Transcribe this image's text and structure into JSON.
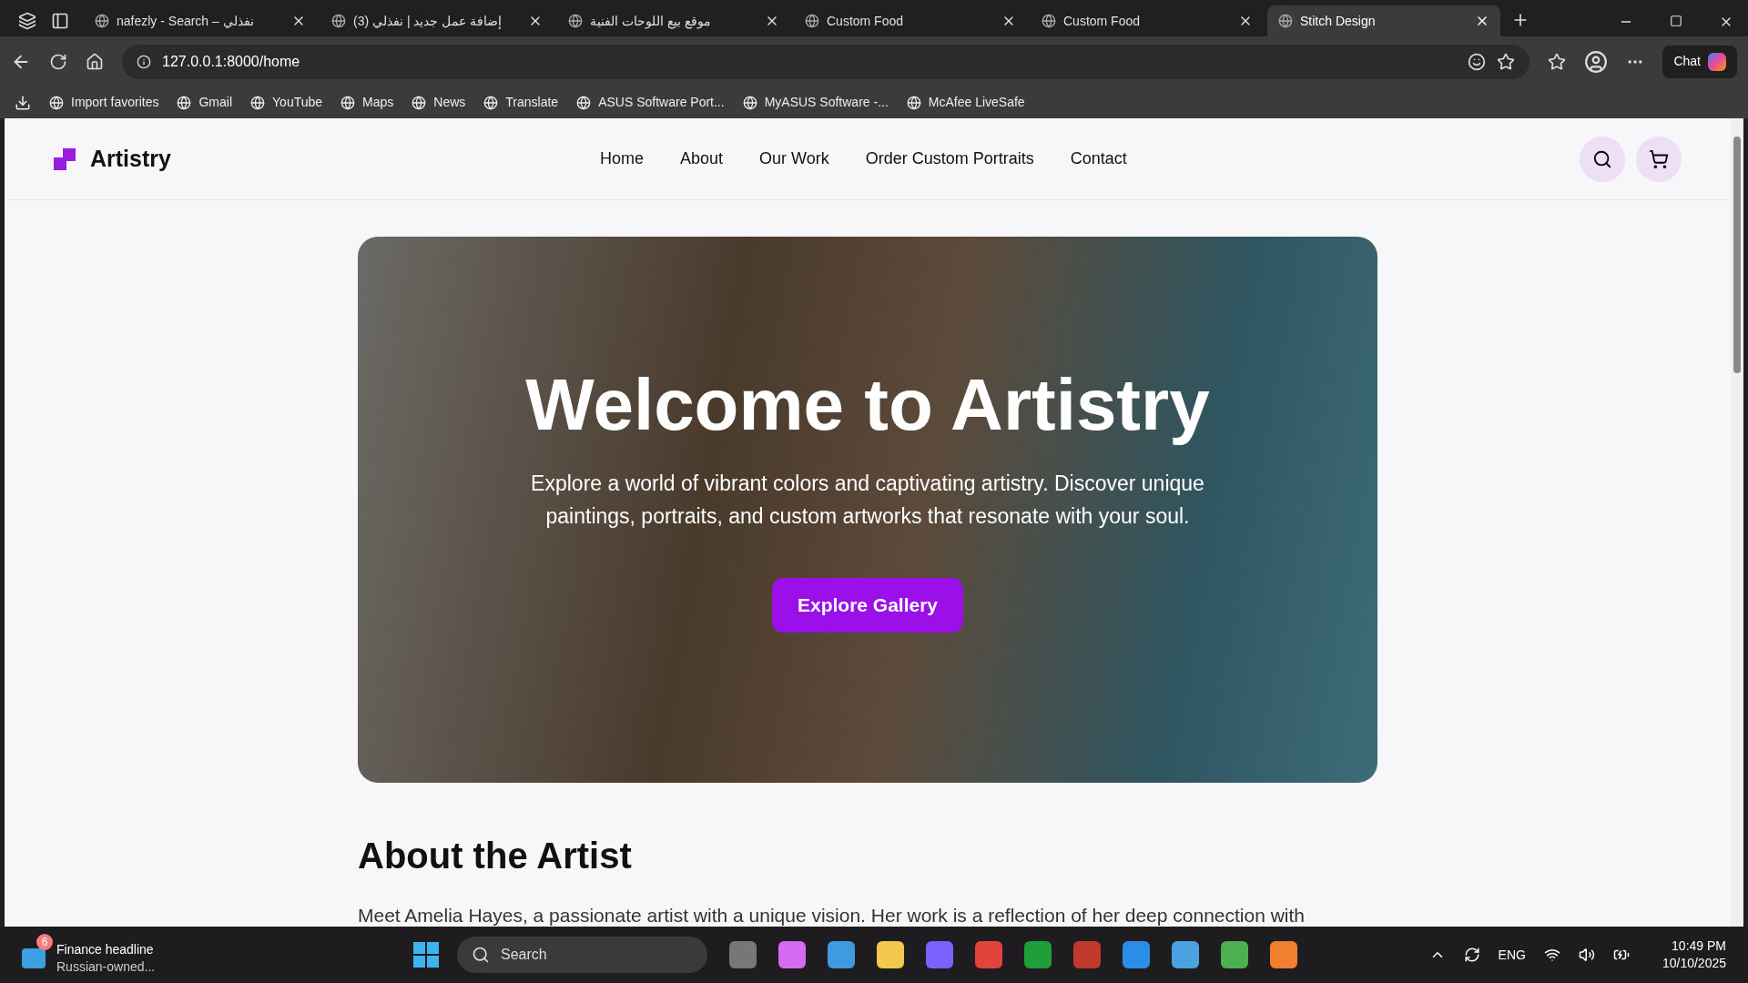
{
  "browser": {
    "tabs": [
      {
        "title": "nafezly - Search – نفذلي",
        "selected": false
      },
      {
        "title": "(3) إضافة عمل جديد | نفذلي",
        "selected": false
      },
      {
        "title": "موقع بيع اللوحات الفنية",
        "selected": false
      },
      {
        "title": "Custom Food",
        "selected": false
      },
      {
        "title": "Custom Food",
        "selected": false
      },
      {
        "title": "Stitch Design",
        "selected": true
      }
    ],
    "address": "127.0.0.1:8000/home",
    "chat": "Chat",
    "bookmarks": [
      "Import favorites",
      "Gmail",
      "YouTube",
      "Maps",
      "News",
      "Translate",
      "ASUS Software Port...",
      "MyASUS Software -...",
      "McAfee LiveSafe"
    ]
  },
  "page": {
    "brand": "Artistry",
    "nav": [
      "Home",
      "About",
      "Our Work",
      "Order Custom Portraits",
      "Contact"
    ],
    "hero": {
      "title": "Welcome to Artistry",
      "subtitle": "Explore a world of vibrant colors and captivating artistry. Discover unique paintings, portraits, and custom artworks that resonate with your soul.",
      "button": "Explore Gallery"
    },
    "about": {
      "heading": "About the Artist",
      "text": "Meet Amelia Hayes, a passionate artist with a unique vision. Her work is a reflection of her deep connection with"
    }
  },
  "taskbar": {
    "news": {
      "badge": "6",
      "title": "Finance headline",
      "subtitle": "Russian-owned..."
    },
    "search": "Search",
    "lang": "ENG",
    "time": "10:49 PM",
    "date": "10/10/2025"
  }
}
